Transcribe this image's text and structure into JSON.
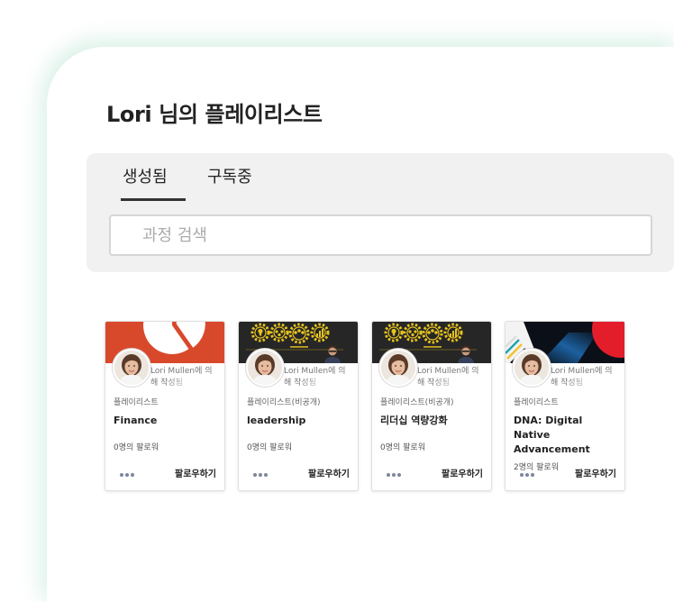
{
  "page": {
    "title": "Lori 님의 플레이리스트"
  },
  "tabs": [
    {
      "label": "생성됨",
      "active": true
    },
    {
      "label": "구독중",
      "active": false
    }
  ],
  "search": {
    "placeholder": "과정 검색"
  },
  "playlists": [
    {
      "author": "Lori Mullen에 의해 작성됨",
      "type": "플레이리스트",
      "title": "Finance",
      "followers": "0명의 팔로워",
      "follow_label": "팔로우하기"
    },
    {
      "author": "Lori Mullen에 의해 작성됨",
      "type": "플레이리스트(비공개)",
      "title": "leadership",
      "followers": "0명의 팔로워",
      "follow_label": "팔로우하기"
    },
    {
      "author": "Lori Mullen에 의해 작성됨",
      "type": "플레이리스트(비공개)",
      "title": "리더십 역량강화",
      "followers": "0명의 팔로워",
      "follow_label": "팔로우하기"
    },
    {
      "author": "Lori Mullen에 의해 작성됨",
      "type": "플레이리스트",
      "title": "DNA: Digital Native Advancement",
      "followers": "2명의 팔로워",
      "follow_label": "팔로우하기"
    }
  ],
  "icons": {
    "more_options": "more-horizontal-icon"
  },
  "colors": {
    "panel_glow": "#8cd0b4",
    "tab_bar_bg": "#f1f1f1",
    "active_tab_underline": "#333333",
    "thumbnail_red": "#d8492c",
    "thumbnail_dark": "#262626",
    "gear_yellow": "#e7c31f",
    "more_icon": "#7d869b"
  }
}
